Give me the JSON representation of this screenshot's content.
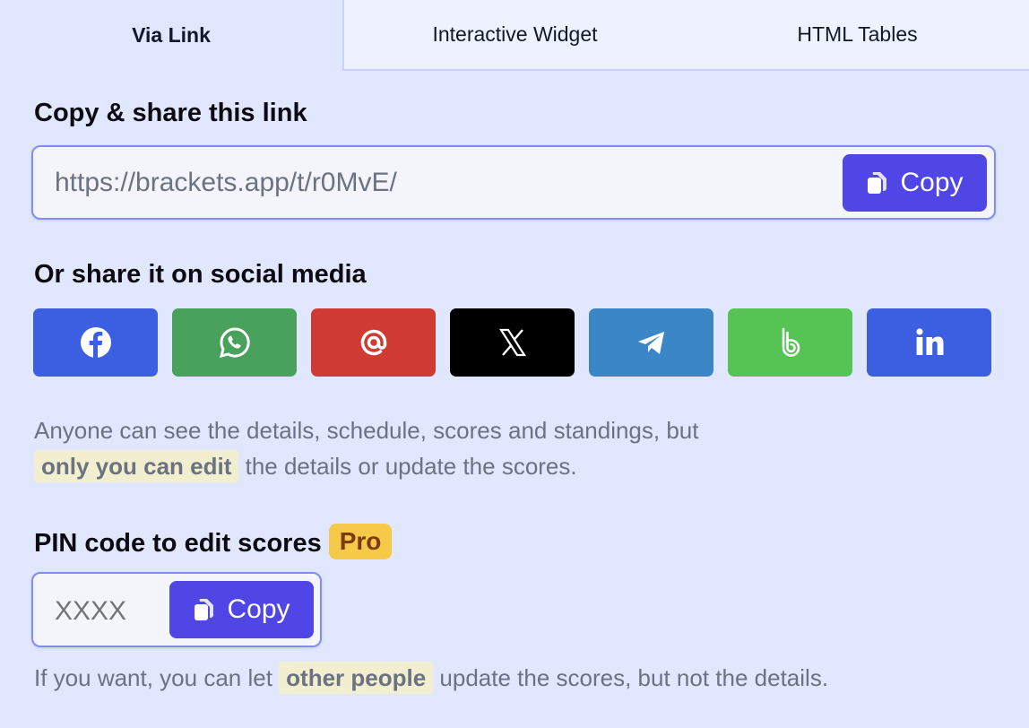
{
  "tabs": [
    {
      "label": "Via Link",
      "active": true
    },
    {
      "label": "Interactive Widget",
      "active": false
    },
    {
      "label": "HTML Tables",
      "active": false
    }
  ],
  "link_section": {
    "heading": "Copy & share this link",
    "url": "https://brackets.app/t/r0MvE/",
    "copy_label": "Copy",
    "copy_icon": "copy-icon"
  },
  "social_section": {
    "heading": "Or share it on social media",
    "buttons": [
      {
        "name": "facebook",
        "icon": "facebook-icon",
        "color": "#3b5fe0"
      },
      {
        "name": "whatsapp",
        "icon": "whatsapp-icon",
        "color": "#48a25b"
      },
      {
        "name": "email",
        "icon": "at-sign-icon",
        "color": "#cf3a33"
      },
      {
        "name": "x",
        "icon": "x-icon",
        "color": "#000000"
      },
      {
        "name": "telegram",
        "icon": "telegram-icon",
        "color": "#3a86c6"
      },
      {
        "name": "bluesky",
        "icon": "b-icon",
        "color": "#56c455"
      },
      {
        "name": "linkedin",
        "icon": "linkedin-icon",
        "color": "#3b5fe0"
      }
    ]
  },
  "visibility_note": {
    "line1": "Anyone can see the details, schedule, scores and standings, but",
    "highlight": "only you can edit",
    "line2_rest": "the details or update the scores."
  },
  "pin_section": {
    "heading": "PIN code to edit scores",
    "badge": "Pro",
    "placeholder": "XXXX",
    "copy_label": "Copy"
  },
  "pin_note": {
    "before": "If you want, you can let",
    "highlight": "other people",
    "after": "update the scores, but not the details."
  },
  "colors": {
    "background": "#e0e7ff",
    "accent": "#4f46e5",
    "border": "#818cf8",
    "pro_badge": "#f7c948"
  }
}
